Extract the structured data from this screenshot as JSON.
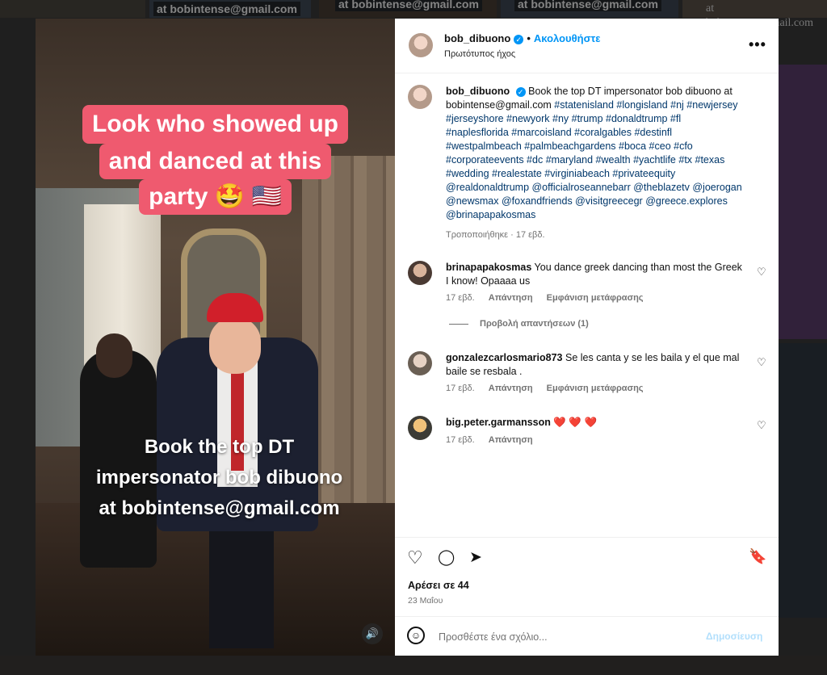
{
  "background": {
    "tiles_text": [
      "at bobintense@gmail.com",
      "at bobintense@gmail.com",
      "at bobintense@gmail.com",
      "at bobintense@gmail.com"
    ]
  },
  "media": {
    "caption_lines": [
      "Look who showed up",
      "and danced at this",
      "party 🤩 🇺🇸"
    ],
    "overlay_lines": [
      "Book the top DT",
      "impersonator bob dibuono",
      "at bobintense@gmail.com"
    ],
    "mute_icon": "🔊"
  },
  "post": {
    "header": {
      "username": "bob_dibuono",
      "verified_icon": "✓",
      "separator": "•",
      "follow_label": "Ακολουθήστε",
      "subtitle": "Πρωτότυπος ήχος",
      "more_icon": "•••"
    },
    "caption": {
      "username": "bob_dibuono",
      "text_prefix": "Book the top DT impersonator bob dibuono at bobintense@gmail.com",
      "tags": "#statenisland #longisland #nj #newjersey #jerseyshore #newyork #ny #trump #donaldtrump #fl #naplesflorida #marcoisland #coralgables #destinfl #westpalmbeach #palmbeachgardens #boca #ceo #cfo #corporateevents #dc #maryland #wealth #yachtlife #tx #texas #wedding #realestate #virginiabeach #privateequity @realdonaldtrump @officialroseannebarr @theblazetv @joerogan @newsmax @foxandfriends @visitgreecegr @greece.explores @brinapapakosmas",
      "meta": "Τροποποιήθηκε · 17 εβδ."
    },
    "comments": [
      {
        "username": "brinapapakosmas",
        "text": "You dance greek dancing than most the Greek I know! Opaaaa us",
        "age": "17 εβδ.",
        "reply_label": "Απάντηση",
        "translate_label": "Εμφάνιση μετάφρασης",
        "view_replies": "Προβολή απαντήσεων (1)"
      },
      {
        "username": "gonzalezcarlosmario873",
        "text": "Se les canta y se les baila y el que mal baile se resbala .",
        "age": "17 εβδ.",
        "reply_label": "Απάντηση",
        "translate_label": "Εμφάνιση μετάφρασης"
      },
      {
        "username": "big.peter.garmansson",
        "text": "❤️ ❤️ ❤️",
        "age": "17 εβδ.",
        "reply_label": "Απάντηση"
      }
    ],
    "actions": {
      "like_icon": "♡",
      "comment_icon": "◯",
      "share_icon": "➤",
      "save_icon": "🔖"
    },
    "likes_text": "Αρέσει σε 44",
    "date_text": "23 Μαΐου",
    "add_comment": {
      "emoji_icon": "☺",
      "placeholder": "Προσθέστε ένα σχόλιο...",
      "post_label": "Δημοσίευση"
    }
  }
}
